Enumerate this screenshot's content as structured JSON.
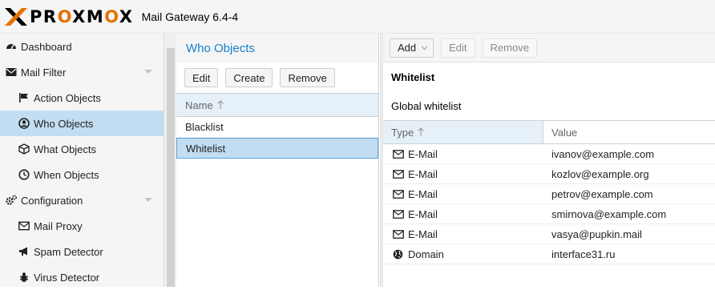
{
  "header": {
    "logo_text_parts": [
      "PR",
      "O",
      "XM",
      "O",
      "X"
    ],
    "version": "Mail Gateway 6.4-4"
  },
  "sidebar": {
    "items": [
      {
        "label": "Dashboard",
        "icon": "dashboard-icon"
      },
      {
        "label": "Mail Filter",
        "icon": "envelope-icon"
      },
      {
        "label": "Action Objects",
        "icon": "flag-icon"
      },
      {
        "label": "Who Objects",
        "icon": "user-circle-icon"
      },
      {
        "label": "What Objects",
        "icon": "cube-icon"
      },
      {
        "label": "When Objects",
        "icon": "clock-icon"
      },
      {
        "label": "Configuration",
        "icon": "gears-icon"
      },
      {
        "label": "Mail Proxy",
        "icon": "envelope-icon"
      },
      {
        "label": "Spam Detector",
        "icon": "bullhorn-icon"
      },
      {
        "label": "Virus Detector",
        "icon": "bug-icon"
      }
    ]
  },
  "who_objects": {
    "title": "Who Objects",
    "toolbar": {
      "edit": "Edit",
      "create": "Create",
      "remove": "Remove"
    },
    "column_name": "Name",
    "rows": [
      "Blacklist",
      "Whitelist"
    ]
  },
  "detail": {
    "toolbar": {
      "add": "Add",
      "edit": "Edit",
      "remove": "Remove"
    },
    "title": "Whitelist",
    "description": "Global whitelist",
    "columns": {
      "type": "Type",
      "value": "Value"
    },
    "rows": [
      {
        "type": "E-Mail",
        "value": "ivanov@example.com",
        "icon": "envelope-icon"
      },
      {
        "type": "E-Mail",
        "value": "kozlov@example.org",
        "icon": "envelope-icon"
      },
      {
        "type": "E-Mail",
        "value": "petrov@example.com",
        "icon": "envelope-icon"
      },
      {
        "type": "E-Mail",
        "value": "smirnova@example.com",
        "icon": "envelope-icon"
      },
      {
        "type": "E-Mail",
        "value": "vasya@pupkin.mail",
        "icon": "envelope-icon"
      },
      {
        "type": "Domain",
        "value": "interface31.ru",
        "icon": "globe-icon"
      }
    ]
  },
  "colors": {
    "accent": "#157fcc",
    "selected": "#c2ddf2",
    "logo_orange": "#e57000"
  }
}
